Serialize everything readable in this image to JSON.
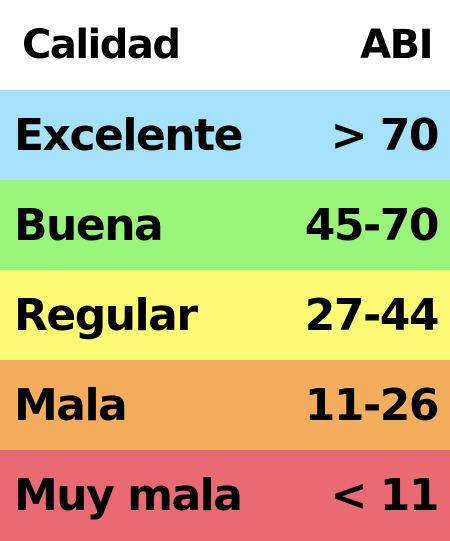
{
  "header": {
    "quality_label": "Calidad",
    "index_label": "ABI"
  },
  "rows": [
    {
      "quality": "Excelente",
      "range": "> 70",
      "color": "#a6e1fa"
    },
    {
      "quality": "Buena",
      "range": "45-70",
      "color": "#99f57a"
    },
    {
      "quality": "Regular",
      "range": "27-44",
      "color": "#fdfb76"
    },
    {
      "quality": "Mala",
      "range": "11-26",
      "color": "#f4ad5c"
    },
    {
      "quality": "Muy mala",
      "range": "< 11",
      "color": "#e96a72"
    }
  ]
}
